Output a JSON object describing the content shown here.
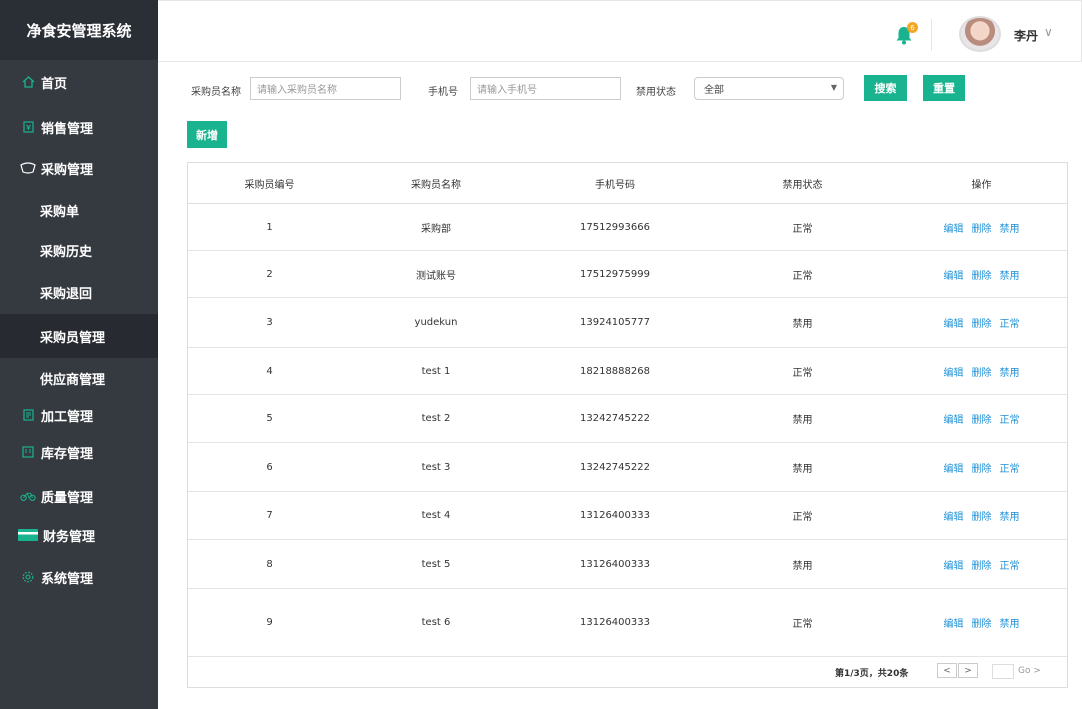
{
  "app": {
    "title": "净食安管理系统"
  },
  "sidebar": {
    "items": [
      {
        "label": "首页",
        "icon": "home-icon"
      },
      {
        "label": "销售管理",
        "icon": "sales-icon"
      },
      {
        "label": "采购管理",
        "icon": "purchase-icon"
      },
      {
        "label": "加工管理",
        "icon": "process-icon"
      },
      {
        "label": "库存管理",
        "icon": "inventory-icon"
      },
      {
        "label": "质量管理",
        "icon": "quality-icon"
      },
      {
        "label": "财务管理",
        "icon": "finance-icon"
      },
      {
        "label": "系统管理",
        "icon": "settings-icon"
      }
    ],
    "sub_items": [
      {
        "label": "采购单"
      },
      {
        "label": "采购历史"
      },
      {
        "label": "采购退回"
      },
      {
        "label": "采购员管理",
        "active": true
      },
      {
        "label": "供应商管理"
      }
    ]
  },
  "header": {
    "notification_count": "6",
    "username": "李丹",
    "chevron": "∨"
  },
  "filters": {
    "name_label": "采购员名称",
    "name_placeholder": "请输入采购员名称",
    "phone_label": "手机号",
    "phone_placeholder": "请输入手机号",
    "status_label": "禁用状态",
    "status_value": "全部",
    "search_label": "搜索",
    "reset_label": "重置",
    "add_label": "新增"
  },
  "table": {
    "columns": [
      "采购员编号",
      "采购员名称",
      "手机号码",
      "禁用状态",
      "操作"
    ],
    "rows": [
      {
        "id": "1",
        "name": "采购部",
        "phone": "17512993666",
        "status": "正常",
        "a1": "编辑",
        "a2": "删除",
        "a3": "禁用"
      },
      {
        "id": "2",
        "name": "测试账号",
        "phone": "17512975999",
        "status": "正常",
        "a1": "编辑",
        "a2": "删除",
        "a3": "禁用"
      },
      {
        "id": "3",
        "name": "yudekun",
        "phone": "13924105777",
        "status": "禁用",
        "a1": "编辑",
        "a2": "删除",
        "a3": "正常"
      },
      {
        "id": "4",
        "name": "test 1",
        "phone": "18218888268",
        "status": "正常",
        "a1": "编辑",
        "a2": "删除",
        "a3": "禁用"
      },
      {
        "id": "5",
        "name": "test 2",
        "phone": "13242745222",
        "status": "禁用",
        "a1": "编辑",
        "a2": "删除",
        "a3": "正常"
      },
      {
        "id": "6",
        "name": "test 3",
        "phone": "13242745222",
        "status": "禁用",
        "a1": "编辑",
        "a2": "删除",
        "a3": "正常"
      },
      {
        "id": "7",
        "name": "test 4",
        "phone": "13126400333",
        "status": "正常",
        "a1": "编辑",
        "a2": "删除",
        "a3": "禁用"
      },
      {
        "id": "8",
        "name": "test 5",
        "phone": "13126400333",
        "status": "禁用",
        "a1": "编辑",
        "a2": "删除",
        "a3": "正常"
      },
      {
        "id": "9",
        "name": "test 6",
        "phone": "13126400333",
        "status": "正常",
        "a1": "编辑",
        "a2": "删除",
        "a3": "禁用"
      }
    ]
  },
  "pagination": {
    "info": "第1/3页，共20条",
    "prev": "<",
    "next": ">",
    "go": "Go >"
  },
  "colors": {
    "accent": "#19b48f",
    "sidebar_bg": "#353a40",
    "link": "#1e90d6",
    "badge": "#f5a623"
  }
}
